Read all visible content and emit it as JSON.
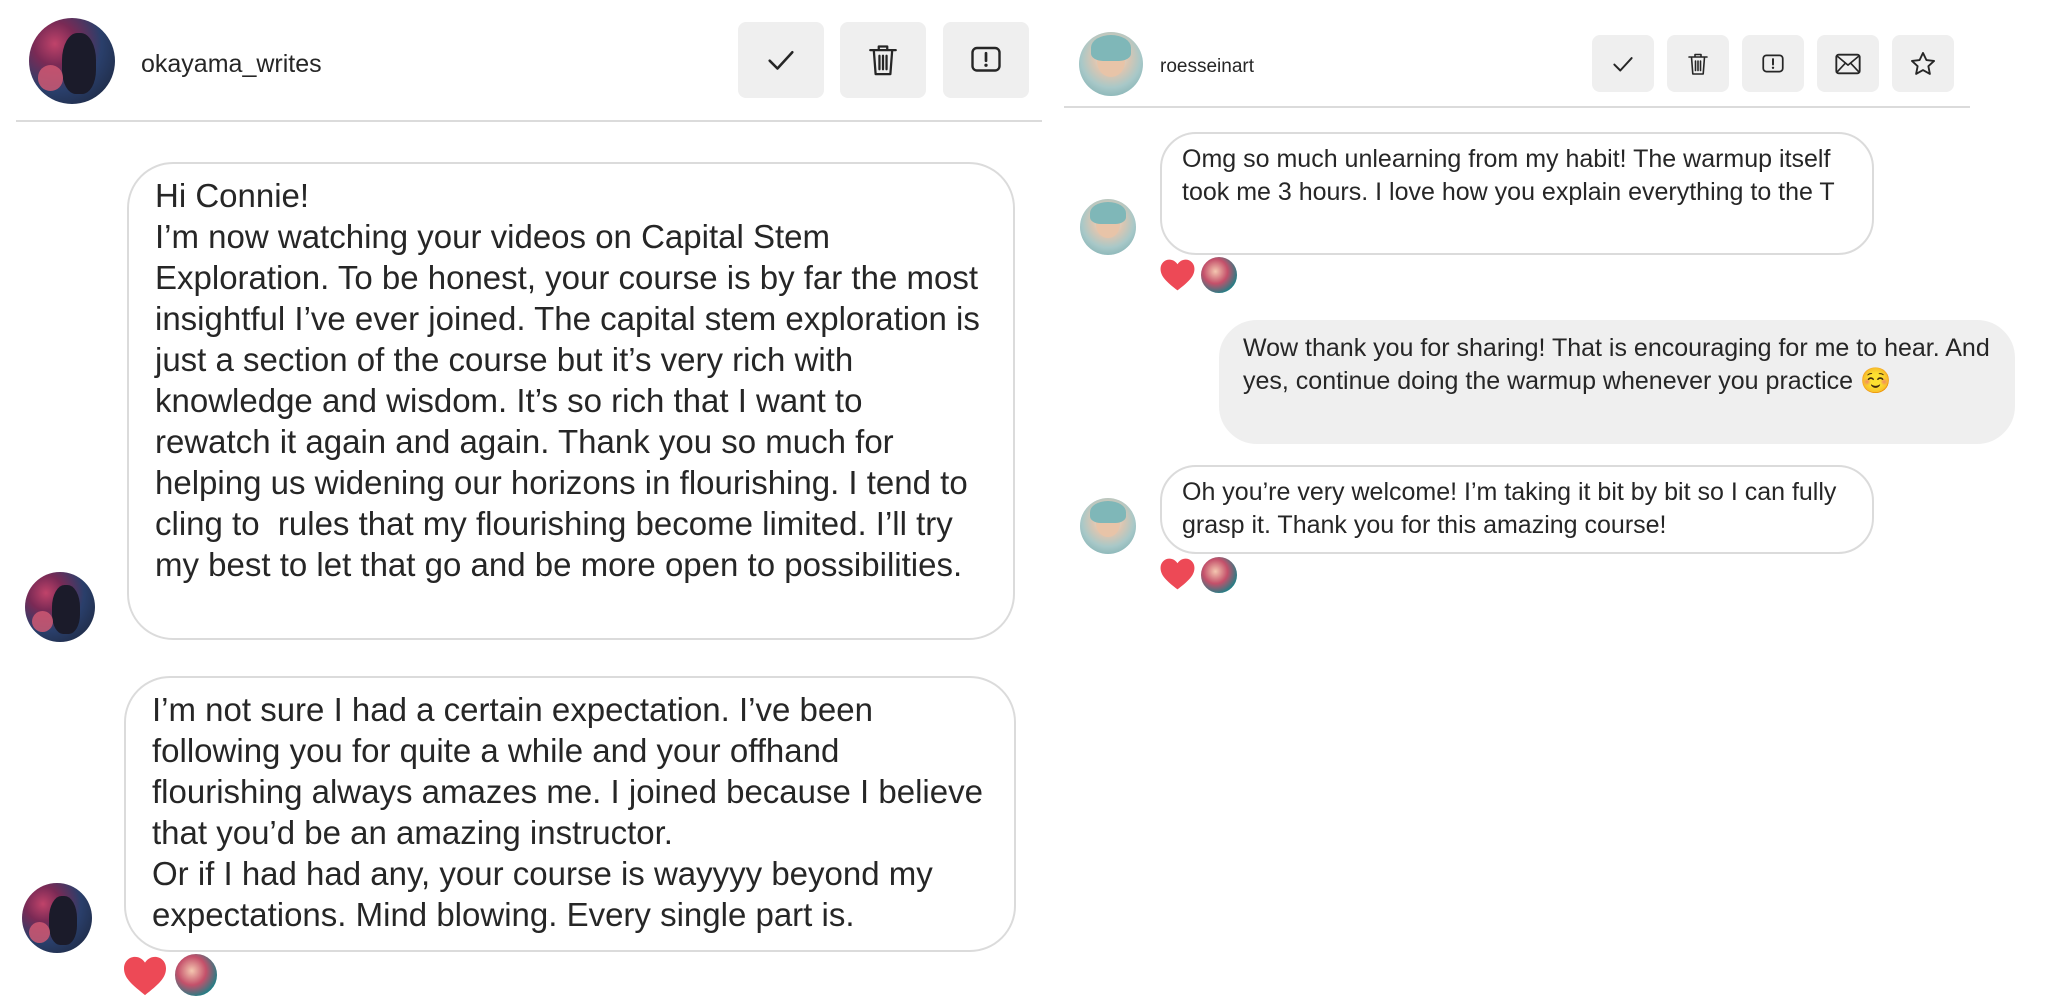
{
  "left_panel": {
    "username": "okayama_writes",
    "actions": [
      "checkmark-icon",
      "trash-icon",
      "report-icon"
    ],
    "messages": [
      {
        "text": "Hi Connie!\nI’m now watching your videos on Capital Stem Exploration. To be honest, your course is by far the most insightful I’ve ever joined. The capital stem exploration is just a section of the course but it’s very rich with knowledge and wisdom. It’s so rich that I want to rewatch it again and again. Thank you so much for helping us widening our horizons in flourishing. I tend to cling to  rules that my flourishing become limited. I’ll try my best to let that go and be more open to possibilities."
      },
      {
        "text": "I’m not sure I had a certain expectation. I’ve been following you for quite a while and your offhand flourishing always amazes me. I joined because I believe that you’d be an amazing instructor.\nOr if I had had any, your course is wayyyy beyond my expectations. Mind blowing. Every single part is."
      }
    ]
  },
  "right_panel": {
    "username": "roesseinart",
    "actions": [
      "checkmark-icon",
      "trash-icon",
      "report-icon",
      "mail-icon",
      "star-icon"
    ],
    "messages": [
      {
        "text": "Omg so much unlearning from my habit! The warmup itself took me 3 hours. I love how you explain everything to the T"
      },
      {
        "text": "Wow thank you for sharing! That is encouraging for me to hear. And yes, continue doing the warmup whenever you practice ☺️"
      },
      {
        "text": "Oh you’re very welcome! I’m taking it bit by bit so I can fully grasp it. Thank you for this amazing course!"
      }
    ]
  },
  "colors": {
    "heart": "#ed4956",
    "bubble_border": "#dbdbdb",
    "own_bubble": "#efefef",
    "button_bg": "#efefef"
  }
}
